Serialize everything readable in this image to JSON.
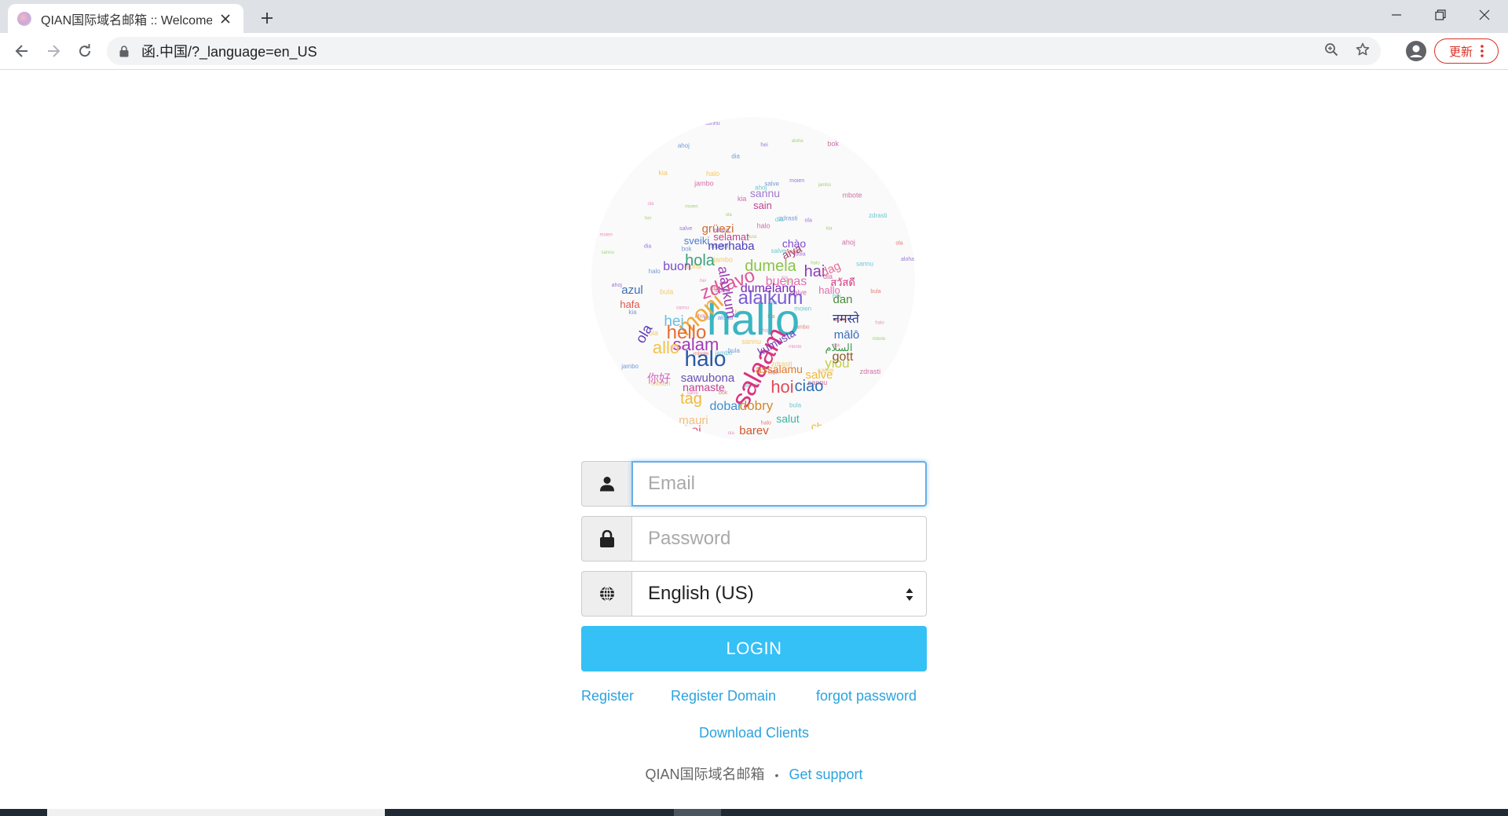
{
  "browser": {
    "tab_title": "QIAN国际域名邮箱 :: Welcome",
    "url": "函.中国/?_language=en_US",
    "update_label": "更新",
    "icons": [
      "favicon",
      "close-icon",
      "plus-icon",
      "minimize-icon",
      "restore-icon",
      "window-close-icon",
      "back-arrow-icon",
      "forward-arrow-icon",
      "reload-icon",
      "lock-icon",
      "zoom-icon",
      "star-icon",
      "profile-icon",
      "kebab-menu-icon"
    ]
  },
  "login": {
    "email_placeholder": "Email",
    "email_value": "",
    "password_placeholder": "Password",
    "password_value": "",
    "language_selected": "English (US)",
    "login_button": "LOGIN",
    "icons": [
      "user-icon",
      "lock-icon",
      "globe-icon",
      "select-arrows-icon"
    ]
  },
  "links": {
    "register": "Register",
    "register_domain": "Register Domain",
    "forgot_password": "forgot password",
    "download_clients": "Download Clients"
  },
  "footer": {
    "brand": "QIAN国际域名邮箱",
    "separator": "•",
    "support": "Get support"
  },
  "logo_words": [
    {
      "text": "hallo",
      "color": "#3ab5c4"
    },
    {
      "text": "salaam",
      "color": "#d9337f"
    },
    {
      "text": "moni",
      "color": "#f1a93b"
    },
    {
      "text": "halo",
      "color": "#2b57a8"
    },
    {
      "text": "alaikum",
      "color": "#7a5bd6"
    },
    {
      "text": "zdravo",
      "color": "#e0559a"
    },
    {
      "text": "hello",
      "color": "#e86b2e"
    },
    {
      "text": "salam",
      "color": "#a13ab8"
    },
    {
      "text": "hola",
      "color": "#3aa07c"
    },
    {
      "text": "dumela",
      "color": "#8bc34a"
    },
    {
      "text": "alaykum",
      "color": "#9b3ab3"
    },
    {
      "text": "ciao",
      "color": "#2b6fb3"
    },
    {
      "text": "hoi",
      "color": "#e04a5a"
    },
    {
      "text": "sawubona",
      "color": "#6a4fb3"
    },
    {
      "text": "namaste",
      "color": "#c2418f"
    },
    {
      "text": "tag",
      "color": "#f0b93a"
    },
    {
      "text": "dobar",
      "color": "#3b8fcf"
    },
    {
      "text": "dobry",
      "color": "#d18a2a"
    },
    {
      "text": "merhaba",
      "color": "#4a3ab8"
    },
    {
      "text": "selamat",
      "color": "#c2418f"
    },
    {
      "text": "sveiki",
      "color": "#4a7ad0"
    },
    {
      "text": "grüezi",
      "color": "#d06a2a"
    },
    {
      "text": "chào",
      "color": "#7a4ad0"
    },
    {
      "text": "buenas",
      "color": "#e86bb0"
    },
    {
      "text": "ola",
      "color": "#5c3ab8"
    },
    {
      "text": "allo",
      "color": "#f1c24a"
    },
    {
      "text": "azul",
      "color": "#3b6fb3"
    },
    {
      "text": "hafa",
      "color": "#e0554a"
    },
    {
      "text": "salut",
      "color": "#3ab5a4"
    },
    {
      "text": "barev",
      "color": "#d0552a"
    },
    {
      "text": "hej",
      "color": "#6ac0e0"
    },
    {
      "text": "salve",
      "color": "#f0b93a"
    },
    {
      "text": "yiou",
      "color": "#c0d040"
    },
    {
      "text": "assalamu",
      "color": "#e07a2a"
    },
    {
      "text": "sannu",
      "color": "#a07ad0"
    },
    {
      "text": "sain",
      "color": "#c2418f"
    },
    {
      "text": "hai",
      "color": "#8a3ab8"
    },
    {
      "text": "dag",
      "color": "#e86b9a"
    },
    {
      "text": "dan",
      "color": "#4a8a3a"
    },
    {
      "text": "mālō",
      "color": "#3a6ab8"
    },
    {
      "text": "gott",
      "color": "#8a5a2a"
    },
    {
      "text": "kumusta",
      "color": "#6a3ab8"
    },
    {
      "text": "buon",
      "color": "#7a4ad0"
    },
    {
      "text": "hei",
      "color": "#e04a7a"
    },
    {
      "text": "cao",
      "color": "#3ab5c4"
    },
    {
      "text": "mauri",
      "color": "#f0c080"
    },
    {
      "text": "aiya",
      "color": "#a03a6a"
    },
    {
      "text": "dumelang",
      "color": "#7a2ab8"
    },
    {
      "text": "hallo",
      "color": "#e86bb0"
    },
    {
      "text": "你好",
      "color": "#d06ab8"
    },
    {
      "text": "नमस्ते",
      "color": "#2b3a8a"
    },
    {
      "text": "สวัสดี",
      "color": "#d9337f"
    },
    {
      "text": "السلام",
      "color": "#3a9a4a"
    },
    {
      "text": "cho",
      "color": "#f0b93a"
    }
  ]
}
